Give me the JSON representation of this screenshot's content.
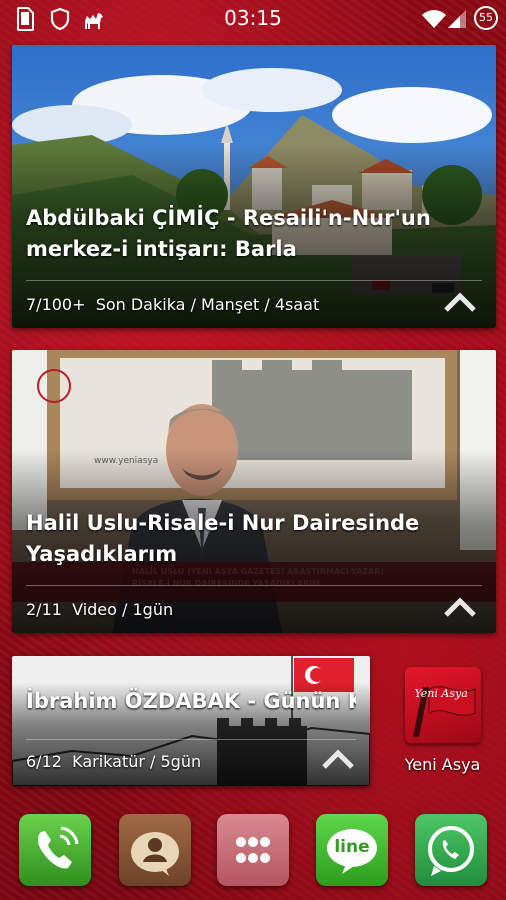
{
  "status_bar": {
    "time": "03:15",
    "battery_level": "55",
    "left_icons": [
      "sim-card-icon",
      "shield-icon",
      "camel-icon"
    ],
    "right_icons": [
      "wifi-icon",
      "signal-icon",
      "battery-icon"
    ]
  },
  "cards": [
    {
      "title": "Abdülbaki ÇİMİÇ - Resaili'n-Nur'un merkez-i intişarı: Barla",
      "count": "7/100+",
      "category": "Son Dakika / Manşet / 4saat"
    },
    {
      "title": "Halil Uslu-Risale-i Nur Dairesinde Yaşadıklarım",
      "count": "2/11",
      "category": "Video / 1gün",
      "overlay_caption_1": "HALİL USLU (YENİ ASYA GAZETESİ ARAŞTIRMACI-YAZAR)",
      "overlay_caption_2": "RİSALE-İ NUR DAİRESİNDE YAŞADIKLARIM",
      "image_watermark": "www.yeniasya"
    },
    {
      "title": "İbrahim ÖZDABAK - Günün Kari...",
      "count": "6/12",
      "category": "Karikatür / 5gün"
    }
  ],
  "app_shortcut": {
    "label": "Yeni Asya",
    "logo_text": "Yeni Asya"
  },
  "dock": [
    "phone-icon",
    "contacts-icon",
    "app-drawer-icon",
    "line-icon",
    "whatsapp-icon"
  ],
  "dock_labels": {
    "line": "line"
  },
  "colors": {
    "wallpaper": "#a00d1a",
    "phone": "#3fae2a",
    "contacts": "#8a5a37",
    "drawer": "#c9707a",
    "line": "#3fbb2c",
    "whatsapp": "#2fa84f"
  }
}
